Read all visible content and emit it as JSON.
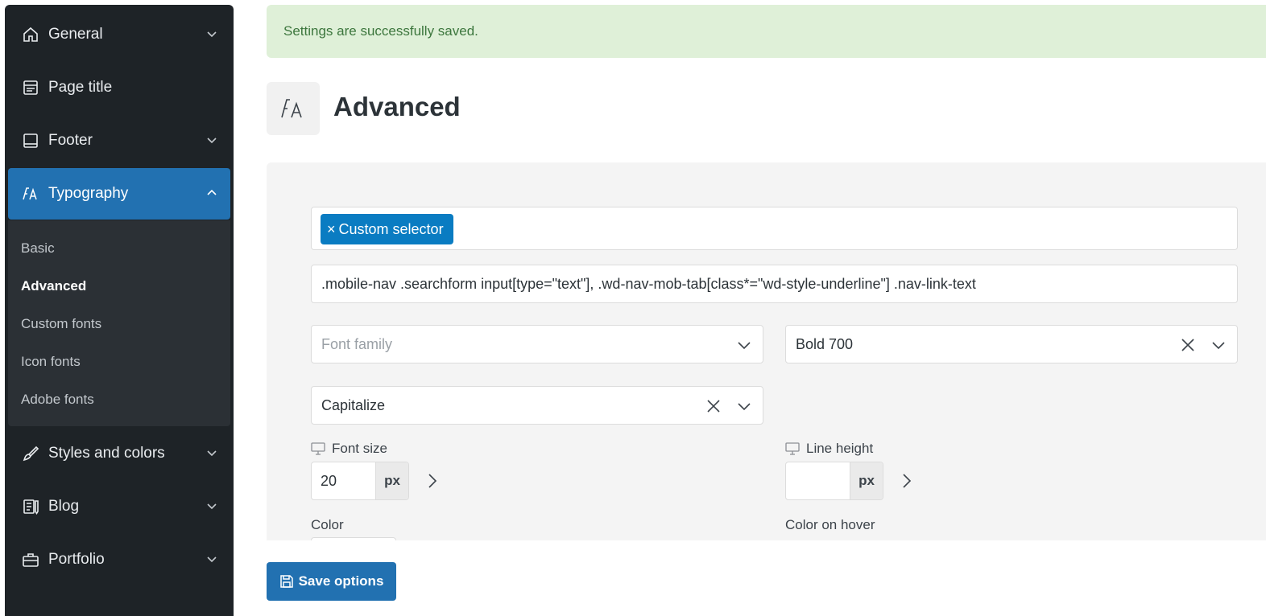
{
  "sidebar": {
    "items": [
      {
        "label": "General",
        "icon": "home-icon"
      },
      {
        "label": "Page title",
        "icon": "page-title-icon"
      },
      {
        "label": "Footer",
        "icon": "footer-icon"
      },
      {
        "label": "Typography",
        "icon": "typography-icon"
      },
      {
        "label": "Styles and colors",
        "icon": "brush-icon"
      },
      {
        "label": "Blog",
        "icon": "blog-icon"
      },
      {
        "label": "Portfolio",
        "icon": "briefcase-icon"
      }
    ],
    "submenu": [
      "Basic",
      "Advanced",
      "Custom fonts",
      "Icon fonts",
      "Adobe fonts"
    ]
  },
  "notice": "Settings are successfully saved.",
  "page": {
    "title": "Advanced"
  },
  "form": {
    "tag": "Custom selector",
    "selector_value": ".mobile-nav .searchform input[type=\"text\"], .wd-nav-mob-tab[class*=\"wd-style-underline\"] .nav-link-text",
    "font_family_placeholder": "Font family",
    "font_weight": "Bold 700",
    "text_transform": "Capitalize",
    "font_size_label": "Font size",
    "font_size_value": "20",
    "font_size_unit": "px",
    "line_height_label": "Line height",
    "line_height_value": "",
    "line_height_unit": "px",
    "color_label": "Color",
    "color_hover_label": "Color on hover"
  },
  "save_button": "Save options",
  "colors": {
    "accent": "#2271b1",
    "sidebar": "#1e2327",
    "notice_bg": "#dff0d8",
    "tag": "#0a7cc2"
  }
}
